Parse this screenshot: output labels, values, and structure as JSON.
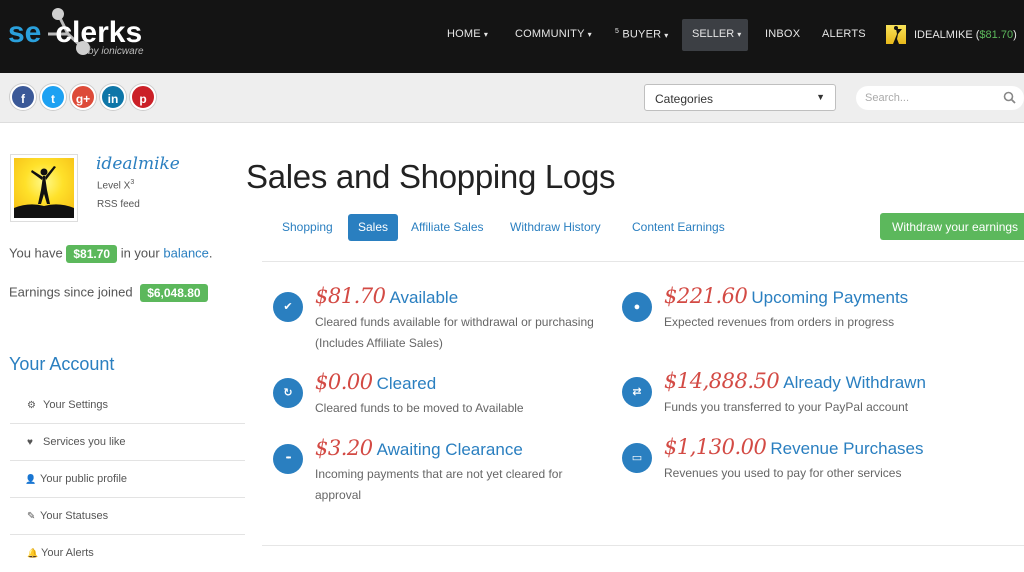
{
  "nav": {
    "logo_prefix": "se",
    "logo_suffix": "clerks",
    "logo_sub": "by ionicware",
    "items": [
      {
        "label": "HOME"
      },
      {
        "label": "COMMUNITY"
      },
      {
        "badge": "5",
        "label": "BUYER"
      },
      {
        "label": "SELLER"
      },
      {
        "label": "INBOX"
      },
      {
        "label": "ALERTS"
      }
    ],
    "username": "IDEALMIKE",
    "balance": "$81.70"
  },
  "social": [
    {
      "name": "facebook",
      "glyph": "f",
      "color": "#3b5998"
    },
    {
      "name": "twitter",
      "glyph": "t",
      "color": "#1da1f2"
    },
    {
      "name": "google-plus",
      "glyph": "g+",
      "color": "#dd4b39"
    },
    {
      "name": "linkedin",
      "glyph": "in",
      "color": "#0e76a8"
    },
    {
      "name": "pinterest",
      "glyph": "p",
      "color": "#cb2027"
    }
  ],
  "categories": {
    "label": "Categories"
  },
  "search": {
    "placeholder": "Search..."
  },
  "profile": {
    "username": "idealmike",
    "level_text": "Level X",
    "level_sup": "3",
    "rss": "RSS feed",
    "balance_pre": "You have",
    "balance": "$81.70",
    "balance_mid": "in your",
    "balance_link": "balance",
    "balance_end": ".",
    "earnings_label": "Earnings since joined",
    "earnings": "$6,048.80"
  },
  "account": {
    "title": "Your Account",
    "items": [
      {
        "icon": "gears-icon",
        "glyph": "⚙",
        "label": "Your Settings"
      },
      {
        "icon": "heart-icon",
        "glyph": "♥",
        "label": "Services you like"
      },
      {
        "icon": "user-icon",
        "glyph": "👤",
        "label": "Your public profile"
      },
      {
        "icon": "edit-icon",
        "glyph": "✎",
        "label": "Your Statuses"
      },
      {
        "icon": "bell-icon",
        "glyph": "🔔",
        "label": "Your Alerts"
      }
    ]
  },
  "main": {
    "title": "Sales and Shopping Logs",
    "tabs": [
      {
        "label": "Shopping",
        "active": false
      },
      {
        "label": "Sales",
        "active": true
      },
      {
        "label": "Affiliate Sales",
        "active": false
      },
      {
        "label": "Withdraw History",
        "active": false
      },
      {
        "label": "Content Earnings",
        "active": false
      }
    ],
    "withdraw_label": "Withdraw your earnings",
    "stats": [
      {
        "icon": "check-icon",
        "glyph": "✔",
        "amount": "$81.70",
        "title": "Available",
        "desc": "Cleared funds available for withdrawal or purchasing (Includes Affiliate Sales)"
      },
      {
        "icon": "circle-icon",
        "glyph": "●",
        "amount": "$221.60",
        "title": "Upcoming Payments",
        "desc": "Expected revenues from orders in progress"
      },
      {
        "icon": "refresh-icon",
        "glyph": "↻",
        "amount": "$0.00",
        "title": "Cleared",
        "desc": "Cleared funds to be moved to Available"
      },
      {
        "icon": "exchange-icon",
        "glyph": "⇄",
        "amount": "$14,888.50",
        "title": "Already Withdrawn",
        "desc": "Funds you transferred to your PayPal account"
      },
      {
        "icon": "ellipsis-icon",
        "glyph": "•••",
        "amount": "$3.20",
        "title": "Awaiting Clearance",
        "desc": "Incoming payments that are not yet cleared for approval"
      },
      {
        "icon": "credit-card-icon",
        "glyph": "▭",
        "amount": "$1,130.00",
        "title": "Revenue Purchases",
        "desc": "Revenues you used to pay for other services"
      }
    ]
  },
  "colors": {
    "accent": "#2a7fc0",
    "success": "#5cb85c",
    "amount": "#d34a44",
    "nav_bg": "#141414"
  }
}
